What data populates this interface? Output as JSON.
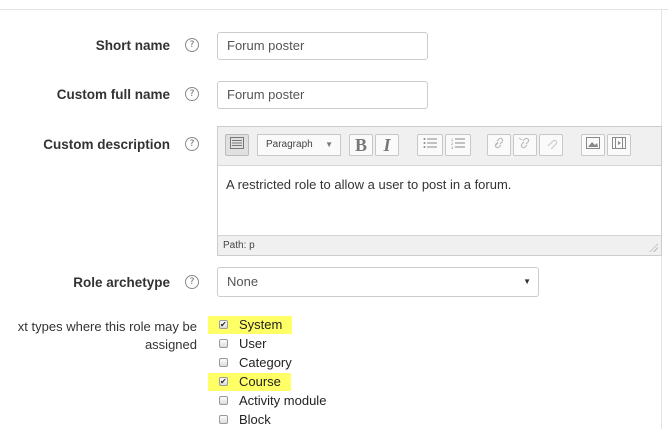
{
  "form": {
    "short_name": {
      "label": "Short name",
      "value": "Forum poster"
    },
    "custom_full_name": {
      "label": "Custom full name",
      "value": "Forum poster"
    },
    "custom_description": {
      "label": "Custom description",
      "format_select": "Paragraph",
      "content": "A restricted role to allow a user to post in a forum.",
      "path": "Path: p",
      "toolbar_icons": [
        "expand-icon",
        "bold-icon",
        "italic-icon",
        "unordered-list-icon",
        "ordered-list-icon",
        "link-icon",
        "unlink-icon",
        "anchor-icon",
        "image-icon",
        "media-icon"
      ]
    },
    "role_archetype": {
      "label": "Role archetype",
      "value": "None"
    },
    "context_types": {
      "label_line1": "xt types where this role may be",
      "label_line2": "assigned",
      "options": [
        {
          "label": "System",
          "checked": true,
          "highlight": true
        },
        {
          "label": "User",
          "checked": false,
          "highlight": false
        },
        {
          "label": "Category",
          "checked": false,
          "highlight": false
        },
        {
          "label": "Course",
          "checked": true,
          "highlight": true
        },
        {
          "label": "Activity module",
          "checked": false,
          "highlight": false
        },
        {
          "label": "Block",
          "checked": false,
          "highlight": false
        }
      ]
    },
    "help_glyph": "?"
  },
  "colors": {
    "highlight": "#ffff66",
    "border": "#cccccc",
    "text": "#333333"
  }
}
